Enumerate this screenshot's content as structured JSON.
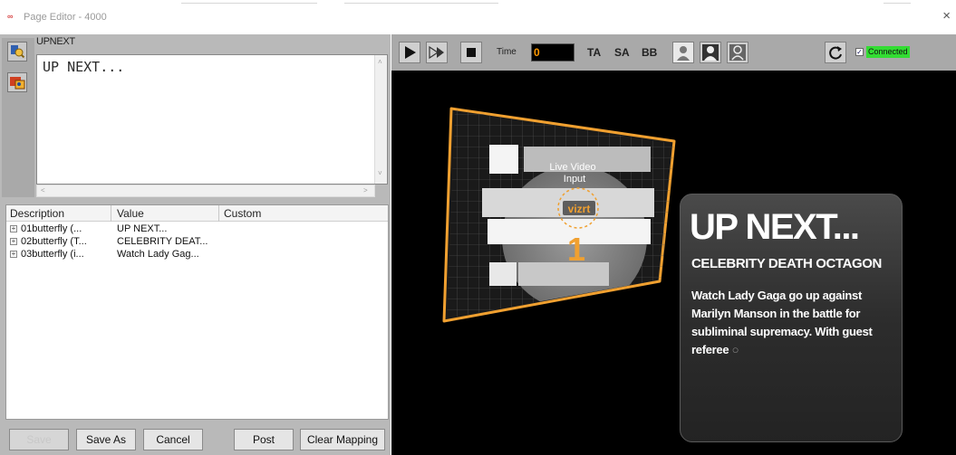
{
  "window": {
    "app_icon": "vizrt-logo-icon",
    "title": "Page Editor - 4000",
    "close_glyph": "×"
  },
  "template": {
    "name": "UPNEXT",
    "tools": [
      "template-tool-icon",
      "image-tool-icon"
    ]
  },
  "editor": {
    "text": "UP NEXT..."
  },
  "table": {
    "headers": [
      "Description",
      "Value",
      "Custom"
    ],
    "rows": [
      {
        "description": "01butterfly (...",
        "value": "UP NEXT..."
      },
      {
        "description": "02butterfly (T...",
        "value": "CELEBRITY DEAT..."
      },
      {
        "description": "03butterfly (i...",
        "value": "Watch Lady Gag..."
      }
    ]
  },
  "buttons": {
    "save": "Save",
    "save_as": "Save As",
    "cancel": "Cancel",
    "post": "Post",
    "clear_mapping": "Clear Mapping"
  },
  "toolbar": {
    "play_icon": "play-icon",
    "continue_icon": "continue-icon",
    "stop_icon": "stop-icon",
    "time_label": "Time",
    "time_value": "0",
    "ta": "TA",
    "sa": "SA",
    "bb": "BB",
    "view_icons": [
      "person-view-icon",
      "person-inverted-view-icon",
      "person-outline-view-icon"
    ],
    "refresh_icon": "refresh-icon",
    "connected_label": "Connected",
    "connected_checked": true,
    "connected_color": "#33dd33"
  },
  "preview": {
    "video_label_line1": "Live Video",
    "video_label_line2": "Input",
    "video_logo": "vizrt",
    "video_number": "1",
    "card_title": "UP NEXT...",
    "card_subtitle": "CELEBRITY DEATH OCTAGON",
    "card_body": "Watch Lady Gaga go up against Marilyn Manson in the battle for subliminal supremacy. With guest referee",
    "accent_color": "#f0a030"
  }
}
